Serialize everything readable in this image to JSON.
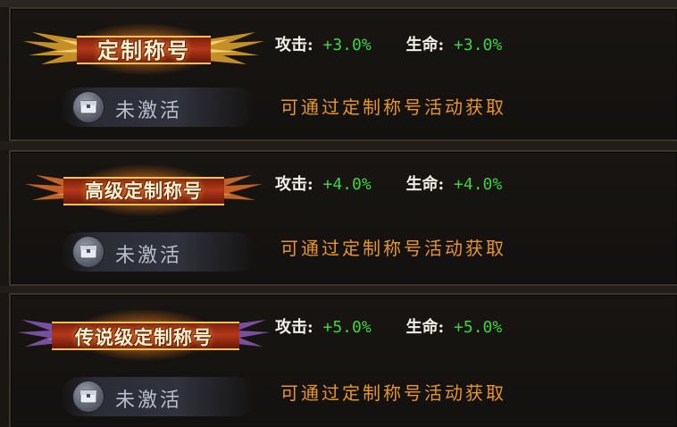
{
  "titles": [
    {
      "name": "定制称号",
      "status": "未激活",
      "attack_label": "攻击:",
      "attack_value": "+3.0%",
      "hp_label": "生命:",
      "hp_value": "+3.0%",
      "hint": "可通过定制称号活动获取"
    },
    {
      "name": "高级定制称号",
      "status": "未激活",
      "attack_label": "攻击:",
      "attack_value": "+4.0%",
      "hp_label": "生命:",
      "hp_value": "+4.0%",
      "hint": "可通过定制称号活动获取"
    },
    {
      "name": "传说级定制称号",
      "status": "未激活",
      "attack_label": "攻击:",
      "attack_value": "+5.0%",
      "hp_label": "生命:",
      "hp_value": "+5.0%",
      "hint": "可通过定制称号活动获取"
    }
  ],
  "icons": {
    "status_icon": "locked-chest-icon",
    "badge_decoration": "golden-wings-icon"
  },
  "colors": {
    "stat_value": "#3fd43f",
    "hint_text": "#e8962a",
    "status_text": "#b9bfcc"
  }
}
